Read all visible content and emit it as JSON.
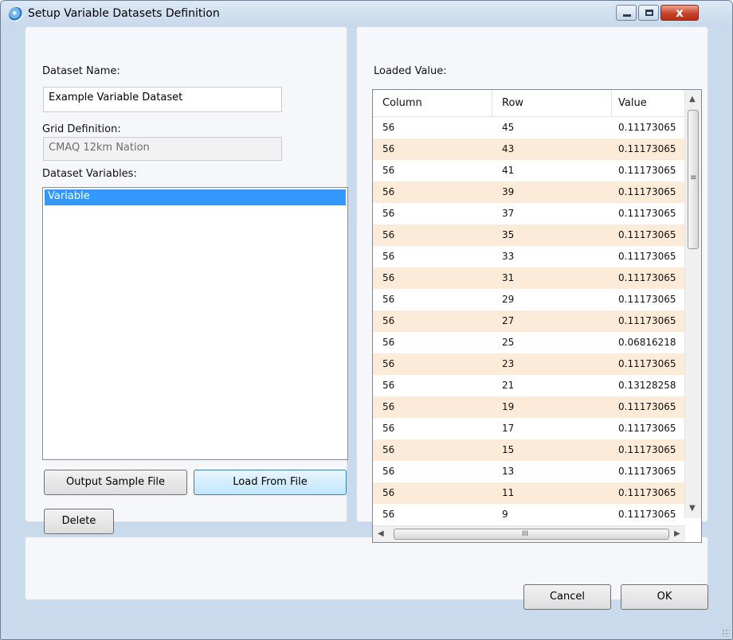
{
  "window": {
    "title": "Setup Variable Datasets Definition",
    "close_symbol": "x",
    "icons": {
      "app": "globe-icon",
      "minimize": "minimize-icon",
      "maximize": "maximize-icon",
      "close": "close-icon"
    }
  },
  "form": {
    "dataset_name_label": "Dataset Name:",
    "dataset_name_value": "Example Variable Dataset",
    "grid_definition_label": "Grid Definition:",
    "grid_definition_value": "CMAQ 12km Nation",
    "dataset_variables_label": "Dataset Variables:",
    "variables": [
      "Variable"
    ]
  },
  "buttons": {
    "output_sample_file": "Output Sample File",
    "load_from_file": "Load From File",
    "delete": "Delete",
    "cancel": "Cancel",
    "ok": "OK"
  },
  "loaded_values": {
    "label": "Loaded Value:",
    "columns": [
      "Column",
      "Row",
      "Value"
    ],
    "rows": [
      [
        "56",
        "45",
        "0.11173065"
      ],
      [
        "56",
        "43",
        "0.11173065"
      ],
      [
        "56",
        "41",
        "0.11173065"
      ],
      [
        "56",
        "39",
        "0.11173065"
      ],
      [
        "56",
        "37",
        "0.11173065"
      ],
      [
        "56",
        "35",
        "0.11173065"
      ],
      [
        "56",
        "33",
        "0.11173065"
      ],
      [
        "56",
        "31",
        "0.11173065"
      ],
      [
        "56",
        "29",
        "0.11173065"
      ],
      [
        "56",
        "27",
        "0.11173065"
      ],
      [
        "56",
        "25",
        "0.06816218"
      ],
      [
        "56",
        "23",
        "0.11173065"
      ],
      [
        "56",
        "21",
        "0.13128258"
      ],
      [
        "56",
        "19",
        "0.11173065"
      ],
      [
        "56",
        "17",
        "0.11173065"
      ],
      [
        "56",
        "15",
        "0.11173065"
      ],
      [
        "56",
        "13",
        "0.11173065"
      ],
      [
        "56",
        "11",
        "0.11173065"
      ],
      [
        "56",
        "9",
        "0.11173065"
      ]
    ],
    "scrollbar_marks": {
      "up": "▲",
      "down": "▼",
      "left": "◀",
      "right": "▶",
      "v_grip": "≡",
      "h_grip": "III"
    }
  },
  "colors": {
    "selection": "#3399ff",
    "alt_row": "#fbebd8",
    "close_button": "#c6452c"
  }
}
